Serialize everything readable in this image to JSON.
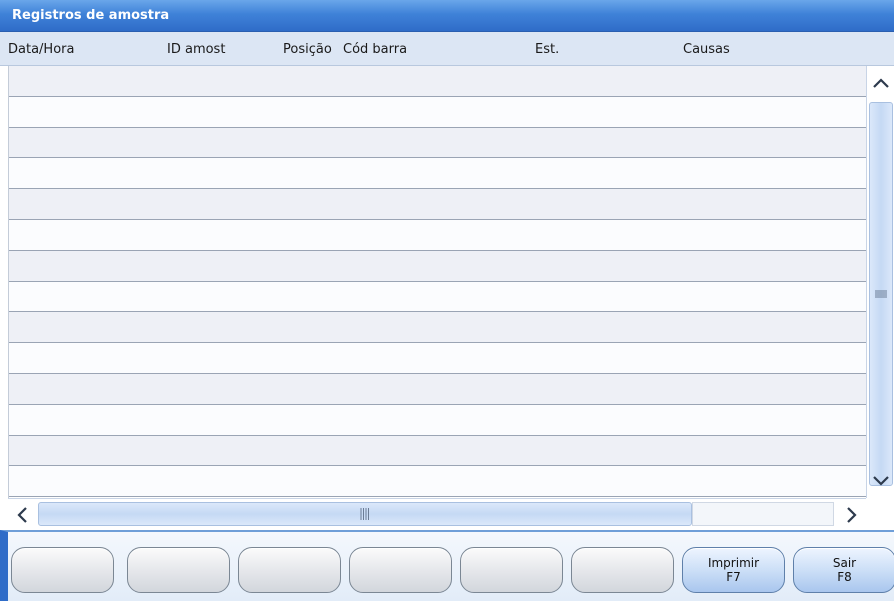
{
  "window": {
    "title": "Registros de amostra"
  },
  "columns": [
    "Data/Hora",
    "ID amost",
    "Posição",
    "Cód barra",
    "Est.",
    "Causas"
  ],
  "rows": 14,
  "buttons": [
    {
      "line1": "",
      "line2": ""
    },
    {
      "line1": "",
      "line2": ""
    },
    {
      "line1": "",
      "line2": ""
    },
    {
      "line1": "",
      "line2": ""
    },
    {
      "line1": "",
      "line2": ""
    },
    {
      "line1": "",
      "line2": ""
    },
    {
      "line1": "Imprimir",
      "line2": "F7"
    },
    {
      "line1": "Sair",
      "line2": "F8"
    }
  ],
  "icons": {
    "scroll_up": "chevron-up-icon",
    "scroll_down": "chevron-down-icon",
    "scroll_left": "chevron-left-icon",
    "scroll_right": "chevron-right-icon",
    "grip": "grip-icon"
  },
  "colors": {
    "accent": "#2f6cc8",
    "header_bg": "#dce6f4",
    "row_alt": "#eef0f6"
  }
}
